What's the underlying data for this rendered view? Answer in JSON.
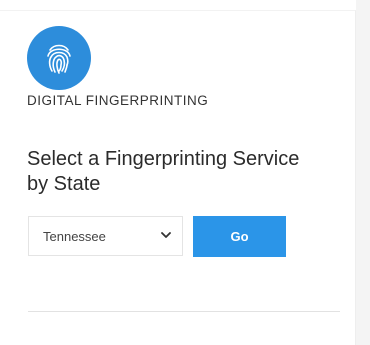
{
  "brand": {
    "name": "DIGITAL FINGERPRINTING",
    "logo_icon": "fingerprint-icon",
    "logo_color": "#2d8ddb"
  },
  "main": {
    "heading": "Select a Fingerprinting Service by State"
  },
  "state_select": {
    "value": "Tennessee",
    "icon": "chevron-down-icon"
  },
  "go_button": {
    "label": "Go",
    "color": "#2b95e8"
  }
}
